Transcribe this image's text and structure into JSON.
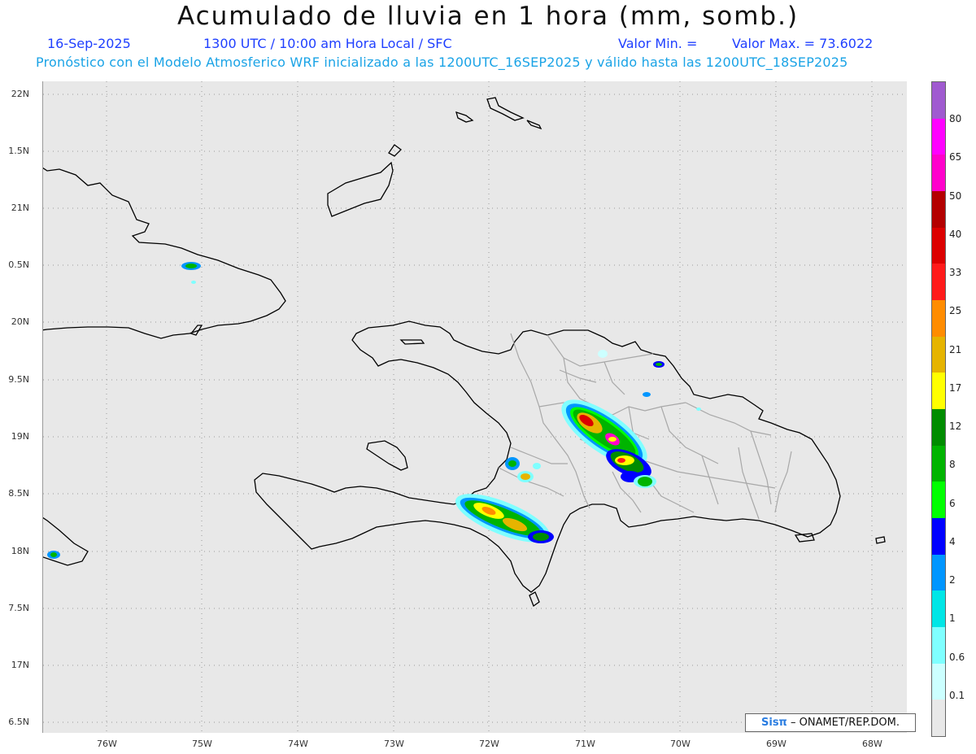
{
  "header": {
    "title": "Acumulado de lluvia en 1 hora (mm, somb.)",
    "date": "16-Sep-2025",
    "time": "1300 UTC / 10:00 am Hora Local / SFC",
    "valor_min_label": "Valor Min. =",
    "valor_max_label": "Valor Max. = 73.6022",
    "model_line": "Pronóstico con el Modelo Atmosferico WRF inicializado a las 1200UTC_16SEP2025 y válido hasta las  1200UTC_18SEP2025"
  },
  "axes": {
    "lat_labels": [
      "22N",
      "1.5N",
      "21N",
      "0.5N",
      "20N",
      "9.5N",
      "19N",
      "8.5N",
      "18N",
      "7.5N",
      "17N",
      "6.5N"
    ],
    "lon_labels": [
      "76W",
      "75W",
      "74W",
      "73W",
      "72W",
      "71W",
      "70W",
      "69W",
      "68W"
    ]
  },
  "credit": {
    "brand": "Sisπ",
    "text": " – ONAMET/REP.DOM."
  },
  "colorbar": {
    "labels": [
      "80",
      "65",
      "50",
      "40",
      "33",
      "25",
      "21",
      "17",
      "12",
      "8",
      "6",
      "4",
      "2",
      "1",
      "0.6",
      "0.1"
    ],
    "colors": [
      "#a05ad0",
      "#ff00ff",
      "#ff00cc",
      "#b40000",
      "#dc0000",
      "#ff1a1a",
      "#ff8c00",
      "#e6b400",
      "#ffff00",
      "#008c00",
      "#00b400",
      "#00ff00",
      "#0000ff",
      "#0096ff",
      "#00e6e6",
      "#7fffff",
      "#ccffff",
      "#e8e8e8"
    ]
  },
  "colors": {
    "land_outline": "#000000",
    "province_outline": "#a8a8a8",
    "ocean": "#e8e8e8"
  }
}
